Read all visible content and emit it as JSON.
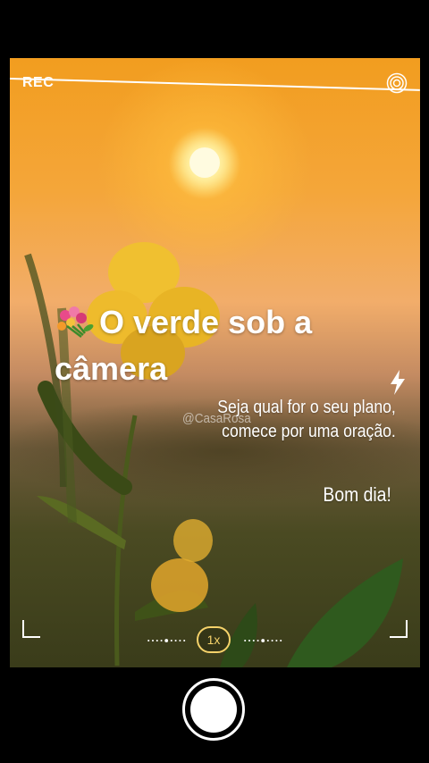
{
  "camera": {
    "rec_label": "REC",
    "zoom_label": "1x"
  },
  "overlay": {
    "title": "O verde sob a câmera",
    "watermark": "@CasaRosa",
    "quote_line1": "Seja qual for o seu plano,",
    "quote_line2": "comece por uma oração.",
    "greeting": "Bom dia!"
  },
  "icons": {
    "top_right": "target-icon",
    "flash": "flash-icon",
    "title_prefix": "bouquet-icon"
  },
  "colors": {
    "accent": "#f5d26a",
    "frame": "#ffffff",
    "background": "#000000"
  }
}
